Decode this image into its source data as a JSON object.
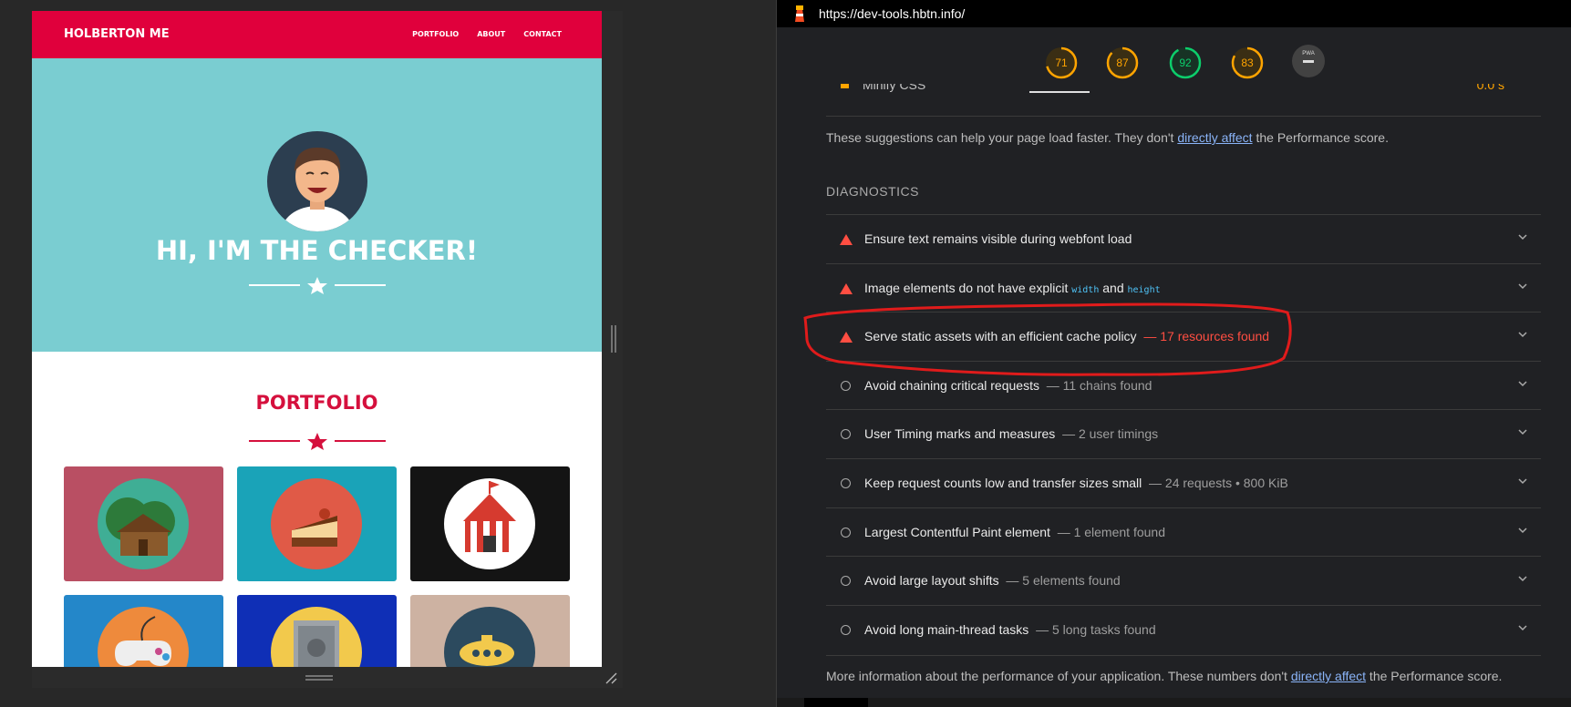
{
  "site": {
    "brand": "HOLBERTON ME",
    "nav": [
      "PORTFOLIO",
      "ABOUT",
      "CONTACT"
    ],
    "hero_title": "HI, I'M THE CHECKER!",
    "portfolio_title": "PORTFOLIO",
    "colors": {
      "nav": "#e0003c",
      "hero": "#7acdd1",
      "accent": "#d5103d"
    },
    "tiles": [
      {
        "name": "cabin",
        "bg": "#b94f63"
      },
      {
        "name": "cake",
        "bg": "#1aa3b8"
      },
      {
        "name": "circus",
        "bg": "#141414"
      },
      {
        "name": "game-controller",
        "bg": "#2487c9"
      },
      {
        "name": "safe",
        "bg": "#0f2fb6"
      },
      {
        "name": "submarine",
        "bg": "#cdb2a2"
      }
    ]
  },
  "lighthouse": {
    "url": "https://dev-tools.hbtn.info/",
    "scores": [
      {
        "value": "71",
        "color": "#ffa400"
      },
      {
        "value": "87",
        "color": "#ffa400"
      },
      {
        "value": "92",
        "color": "#0cce6b"
      },
      {
        "value": "83",
        "color": "#ffa400"
      }
    ],
    "pwa_label": "PWA",
    "previous_row": {
      "label": "Minify CSS",
      "value": "0.0 s"
    },
    "opportunity_note": {
      "before": "These suggestions can help your page load faster. They don't ",
      "link": "directly affect",
      "after": " the Performance score."
    },
    "diagnostics_header": "DIAGNOSTICS",
    "audits": [
      {
        "title": "Ensure text remains visible during webfont load",
        "detail": "",
        "status": "fail"
      },
      {
        "title": "Image elements do not have explicit ",
        "code1": "width",
        "and": " and ",
        "code2": "height",
        "detail": "",
        "status": "fail"
      },
      {
        "title": "Serve static assets with an efficient cache policy",
        "detail": "— 17 resources found",
        "status": "fail"
      },
      {
        "title": "Avoid chaining critical requests",
        "detail": "— 11 chains found",
        "status": "info"
      },
      {
        "title": "User Timing marks and measures",
        "detail": "— 2 user timings",
        "status": "info"
      },
      {
        "title": "Keep request counts low and transfer sizes small",
        "detail": "— 24 requests • 800 KiB",
        "status": "info"
      },
      {
        "title": "Largest Contentful Paint element",
        "detail": "— 1 element found",
        "status": "info"
      },
      {
        "title": "Avoid large layout shifts",
        "detail": "— 5 elements found",
        "status": "info"
      },
      {
        "title": "Avoid long main-thread tasks",
        "detail": "— 5 long tasks found",
        "status": "info"
      }
    ],
    "footer_note": {
      "before": "More information about the performance of your application. These numbers don't ",
      "link": "directly affect",
      "after": " the Performance score."
    },
    "fail_color": "#ff4e42"
  }
}
